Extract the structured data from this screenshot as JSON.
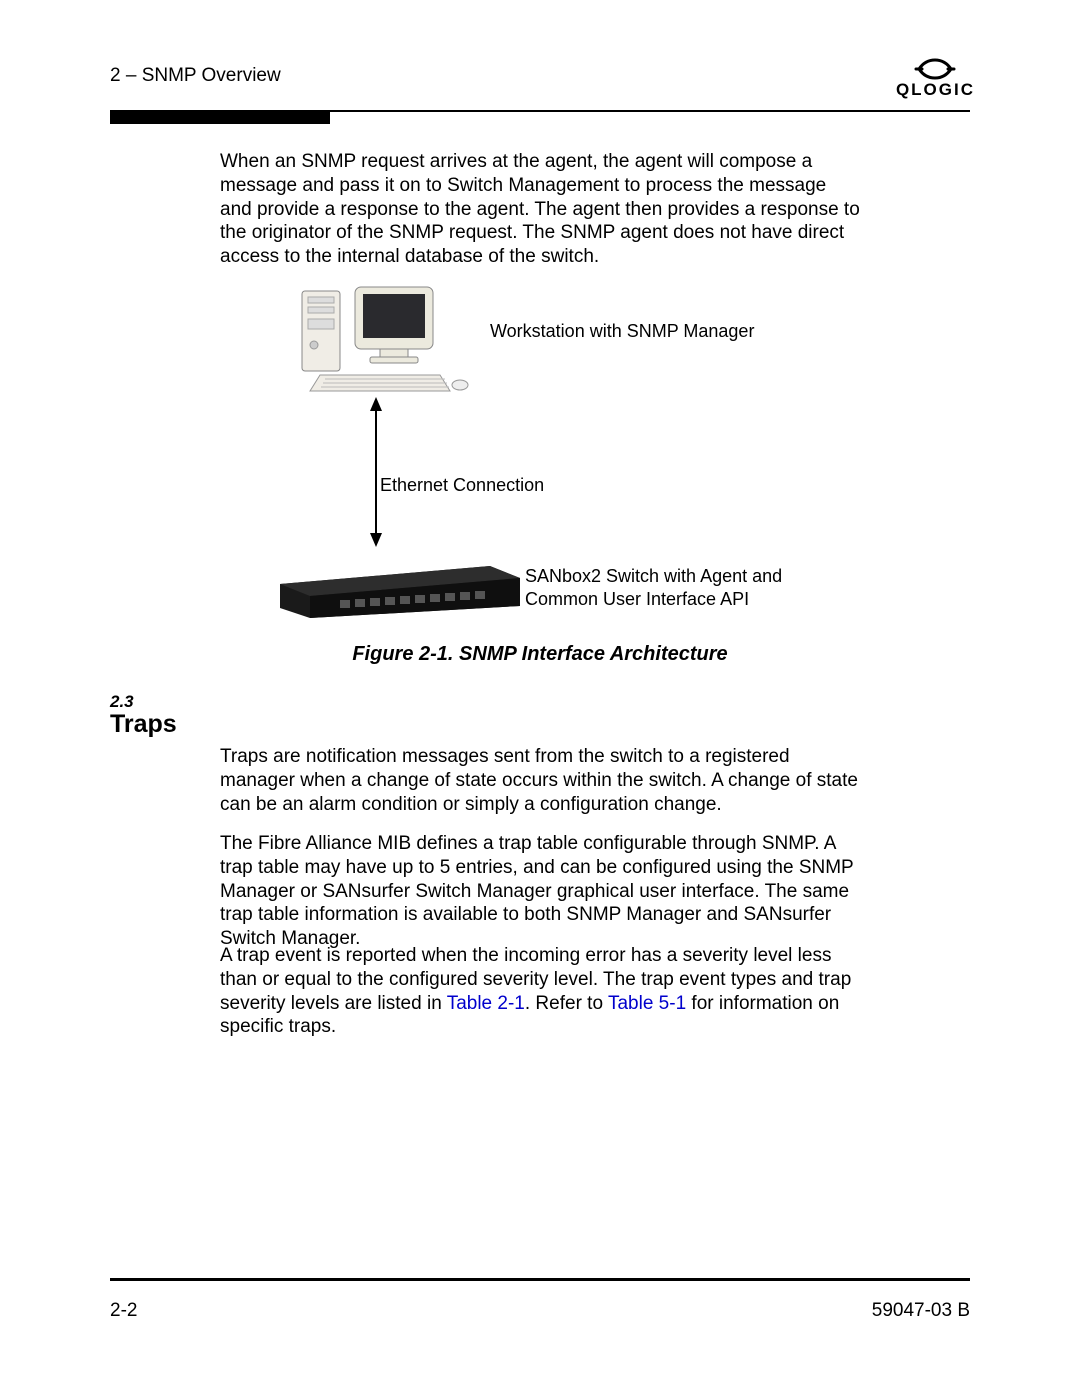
{
  "header": {
    "breadcrumb": "2 – SNMP Overview",
    "logo_word": "QLOGIC"
  },
  "body": {
    "para1": "When an SNMP request arrives at the agent, the agent will compose a message and pass it on to Switch Management to process the message and provide a response to the agent. The agent then provides a response to the originator of the SNMP request. The SNMP agent does not have direct access to the internal database of the switch."
  },
  "figure": {
    "workstation_label": "Workstation with SNMP Manager",
    "ethernet_label": "Ethernet Connection",
    "switch_label_line1": "SANbox2 Switch with Agent and",
    "switch_label_line2": "Common User Interface API",
    "caption": "Figure 2-1.  SNMP Interface Architecture"
  },
  "section": {
    "number": "2.3",
    "title": "Traps",
    "para2": "Traps are notification messages sent from the switch to a registered manager when a change of state occurs within the switch. A change of state can be an alarm condition or simply a configuration change.",
    "para3": "The Fibre Alliance MIB defines a trap table configurable through SNMP. A trap table may have up to 5 entries, and can be configured using the SNMP Manager or SANsurfer Switch Manager graphical user interface. The same trap table information is available to both SNMP Manager and SANsurfer Switch Manager.",
    "para4_a": "A trap event is reported when the incoming error has a severity level less than or equal to the configured severity level. The trap event types and trap severity levels are listed in ",
    "para4_link1": "Table 2-1",
    "para4_b": ". Refer to ",
    "para4_link2": "Table 5-1",
    "para4_c": " for information on specific traps."
  },
  "footer": {
    "page": "2-2",
    "docid": "59047-03  B"
  }
}
